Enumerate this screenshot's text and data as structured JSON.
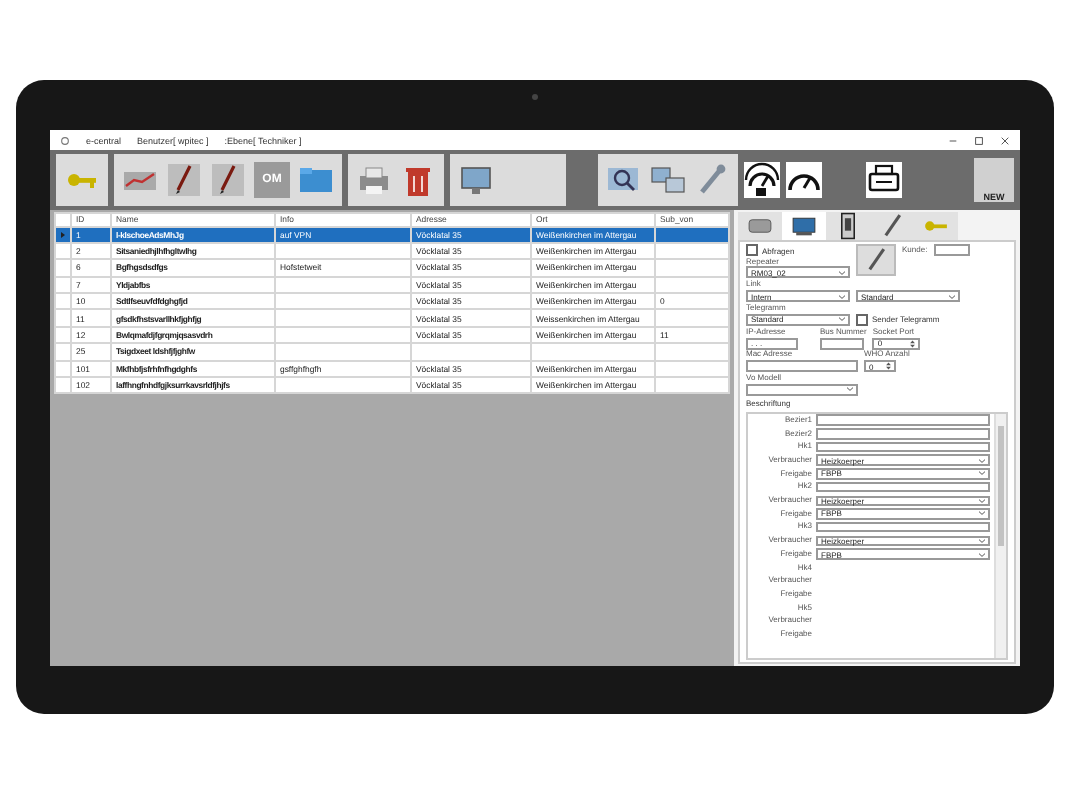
{
  "window": {
    "app": "e-central",
    "user": "Benutzer[ wpitec ]",
    "level": ":Ebene[ Techniker ]"
  },
  "toolbar": {
    "om_label": "OM",
    "new_label": "NEW"
  },
  "table": {
    "columns": [
      "ID",
      "Name",
      "Info",
      "Adresse",
      "Ort",
      "Sub_von"
    ],
    "rows": [
      {
        "cells": [
          "1",
          "l-klschoeAdsMhJg",
          "auf VPN",
          "Vöcklatal 35",
          "Weißenkirchen im Attergau",
          ""
        ],
        "selected": true
      },
      {
        "cells": [
          "2",
          "Sitsaniedhjlhfhgltwlhg",
          "",
          "Vöcklatal 35",
          "Weißenkirchen im Attergau",
          ""
        ],
        "selected": false
      },
      {
        "cells": [
          "6",
          "Bgfhgsdsdfgs",
          "Hofstetweit",
          "Vöcklatal 35",
          "Weißenkirchen im Attergau",
          ""
        ],
        "selected": false
      },
      {
        "cells": [
          "7",
          "Yldjabfbs",
          "",
          "Vöcklatal 35",
          "Weißenkirchen im Attergau",
          ""
        ],
        "selected": false
      },
      {
        "cells": [
          "10",
          "Sdtlfseuvfdfdghgfjd",
          "",
          "Vöcklatal 35",
          "Weißenkirchen im Attergau",
          "0"
        ],
        "selected": false
      },
      {
        "cells": [
          "11",
          "gfsdkfhstsvarllhkfjghfjg",
          "",
          "Vöcklatal 35",
          "Weissenkirchen im Attergau",
          ""
        ],
        "selected": false
      },
      {
        "cells": [
          "12",
          "Bwlqmafdjfgrqmjqsasvdrh",
          "",
          "Vöcklatal 35",
          "Weißenkirchen im Attergau",
          "11"
        ],
        "selected": false
      },
      {
        "cells": [
          "25",
          "Tsigdxeet ldshfjfjghfw",
          "",
          "",
          "",
          ""
        ],
        "selected": false
      },
      {
        "cells": [
          "101",
          "Mkfhbfjsfrhfnfhgdghfs",
          "gsffghfhgfh",
          "Vöcklatal 35",
          "Weißenkirchen im Attergau",
          ""
        ],
        "selected": false
      },
      {
        "cells": [
          "102",
          "laffhngfnhdfgjksurrkavsrldfjhjfs",
          "",
          "Vöcklatal 35",
          "Weißenkirchen im Attergau",
          ""
        ],
        "selected": false
      }
    ]
  },
  "detail": {
    "tabs": [
      {
        "selected": false
      },
      {
        "selected": true
      },
      {
        "selected": false
      },
      {
        "selected": false
      },
      {
        "selected": false
      }
    ],
    "abfragen": {
      "label": "Abfragen",
      "checked": false
    },
    "kunde": {
      "label": "Kunde:"
    },
    "repeater": {
      "label": "Repeater",
      "value": "RM03_02"
    },
    "link": {
      "label": "Link",
      "value": "Intern",
      "value_2": "Standard"
    },
    "telegramm": {
      "label": "Telegramm",
      "value": "Standard"
    },
    "sender_telegramm": {
      "label": "Sender Telegramm",
      "checked": false
    },
    "ip_adresse": {
      "label": "IP-Adresse",
      "value": ".   .   ."
    },
    "bus_nummer": {
      "label": "Bus Nummer"
    },
    "socket_port": {
      "label": "Socket Port",
      "value": "0"
    },
    "mac_adresse": {
      "label": "Mac Adresse"
    },
    "who_anzahl": {
      "label": "WHO Anzahl",
      "value": "0"
    },
    "vo_modell": {
      "label": "Vo Modell"
    },
    "beschriftung": {
      "title": "Beschriftung",
      "rows": [
        {
          "kind": "field",
          "label": "Bezier1"
        },
        {
          "kind": "field",
          "label": "Bezier2"
        },
        {
          "kind": "field",
          "label": "Hk1"
        },
        {
          "kind": "select",
          "label": "Verbraucher",
          "value": "Heizkoerper"
        },
        {
          "kind": "select",
          "label": "Freigabe",
          "value": "FBPB"
        },
        {
          "kind": "field",
          "label": "Hk2"
        },
        {
          "kind": "select",
          "label": "Verbraucher",
          "value": "Heizkoerper"
        },
        {
          "kind": "select",
          "label": "Freigabe",
          "value": "FBPB"
        },
        {
          "kind": "field",
          "label": "Hk3"
        },
        {
          "kind": "select",
          "label": "Verbraucher",
          "value": "Heizkoerper"
        },
        {
          "kind": "select",
          "label": "Freigabe",
          "value": "FBPB"
        },
        {
          "kind": "label",
          "label": "Hk4"
        },
        {
          "kind": "label",
          "label": "Verbraucher"
        },
        {
          "kind": "label",
          "label": "Freigabe"
        },
        {
          "kind": "label",
          "label": "Hk5"
        },
        {
          "kind": "label",
          "label": "Verbraucher"
        },
        {
          "kind": "label",
          "label": "Freigabe"
        }
      ]
    }
  }
}
